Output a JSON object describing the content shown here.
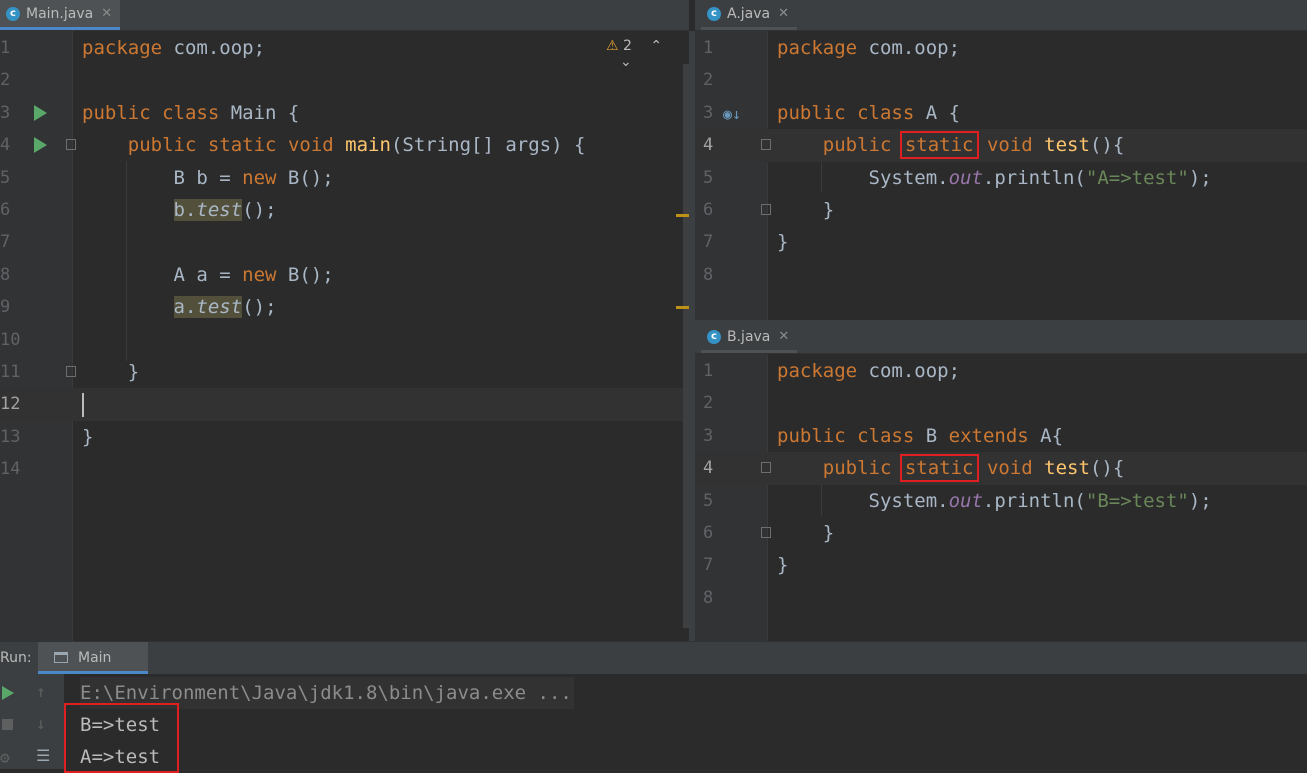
{
  "left_editor": {
    "tab": {
      "icon": "c",
      "label": "Main.java",
      "close": "✕"
    },
    "warning": {
      "icon": "⚠",
      "count": "2",
      "up": "⌃",
      "down": "⌄"
    },
    "line_numbers": [
      "1",
      "2",
      "3",
      "4",
      "5",
      "6",
      "7",
      "8",
      "9",
      "10",
      "11",
      "12",
      "13",
      "14"
    ],
    "lines": {
      "l1": {
        "kw": "package",
        "rest": " com.oop;"
      },
      "l3": {
        "kw1": "public",
        "kw2": "class",
        "rest": " Main {"
      },
      "l4": {
        "indent": "    ",
        "kw1": "public",
        "kw2": "static",
        "kw3": "void",
        "fn": "main",
        "rest": "(String[] args) {"
      },
      "l5": {
        "indent": "        ",
        "pre": "B b = ",
        "kw": "new",
        "rest": " B();"
      },
      "l6": {
        "indent": "        ",
        "var": "b",
        "dot": ".",
        "call": "test",
        "rest": "();"
      },
      "l8": {
        "indent": "        ",
        "pre": "A a = ",
        "kw": "new",
        "rest": " B();"
      },
      "l9": {
        "indent": "        ",
        "var": "a",
        "dot": ".",
        "call": "test",
        "rest": "();"
      },
      "l11": {
        "indent": "    ",
        "rest": "}"
      },
      "l13": {
        "rest": "}"
      }
    }
  },
  "a_editor": {
    "tab": {
      "icon": "c",
      "label": "A.java",
      "close": "✕"
    },
    "line_numbers": [
      "1",
      "2",
      "3",
      "4",
      "5",
      "6",
      "7",
      "8"
    ],
    "lines": {
      "l1": {
        "kw": "package",
        "rest": " com.oop;"
      },
      "l3": {
        "kw1": "public",
        "kw2": "class",
        "rest": " A {"
      },
      "l4": {
        "indent": "    ",
        "kw1": "public",
        "kw2": "static",
        "kw3": "void",
        "fn": "test",
        "rest": "(){"
      },
      "l5": {
        "indent": "        ",
        "pre": "System.",
        "fld": "out",
        "mid": ".println(",
        "str": "\"A=>test\"",
        "rest": ");"
      },
      "l6": {
        "indent": "    ",
        "rest": "}"
      },
      "l7": {
        "rest": "}"
      }
    }
  },
  "b_editor": {
    "tab": {
      "icon": "c",
      "label": "B.java",
      "close": "✕"
    },
    "line_numbers": [
      "1",
      "2",
      "3",
      "4",
      "5",
      "6",
      "7",
      "8"
    ],
    "lines": {
      "l1": {
        "kw": "package",
        "rest": " com.oop;"
      },
      "l3": {
        "kw1": "public",
        "kw2": "class",
        "mid": " B ",
        "kw3": "extends",
        "rest": " A{"
      },
      "l4": {
        "indent": "    ",
        "kw1": "public",
        "kw2": "static",
        "kw3": "void",
        "fn": "test",
        "rest": "(){"
      },
      "l5": {
        "indent": "        ",
        "pre": "System.",
        "fld": "out",
        "mid": ".println(",
        "str": "\"B=>test\"",
        "rest": ");"
      },
      "l6": {
        "indent": "    ",
        "rest": "}"
      },
      "l7": {
        "rest": "}"
      }
    }
  },
  "run_panel": {
    "label": "Run:",
    "tab_label": "Main",
    "command": "E:\\Environment\\Java\\jdk1.8\\bin\\java.exe ...",
    "output": [
      "B=>test",
      "A=>test"
    ]
  },
  "colors": {
    "keyword": "#cc7832",
    "function": "#ffc66d",
    "string": "#6a8759",
    "field": "#9876aa",
    "text": "#a9b7c6",
    "highlight_box": "#e02020"
  }
}
